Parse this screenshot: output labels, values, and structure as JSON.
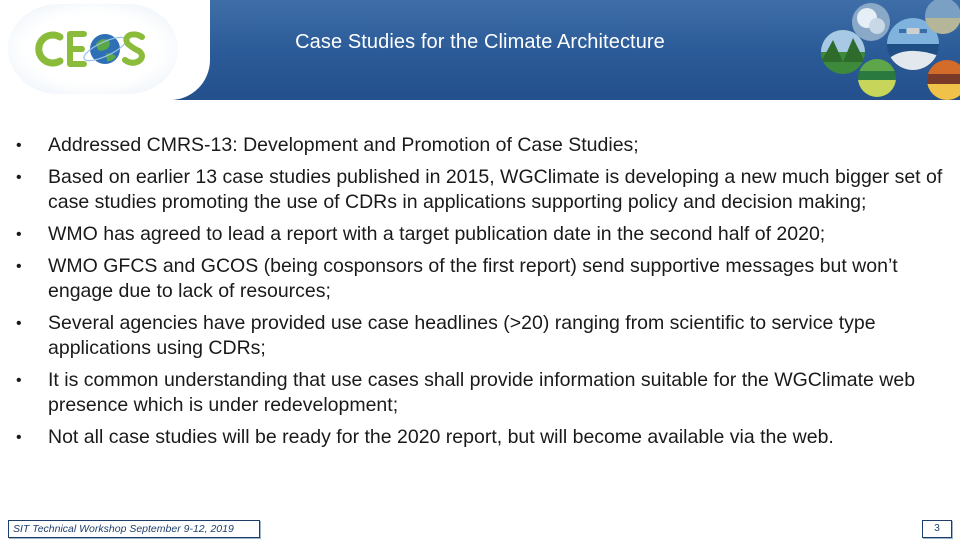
{
  "header": {
    "title": "Case Studies for the Climate Architecture",
    "logo_text": "CEOS"
  },
  "bullets": [
    "Addressed CMRS-13: Development and Promotion of Case Studies;",
    "Based on earlier 13 case studies published in 2015, WGClimate is developing a new much bigger set of case studies promoting the use of CDRs in applications supporting policy and decision making;",
    "WMO has agreed to lead a report with a target publication date in the second half of 2020;",
    "WMO GFCS and GCOS (being cosponsors of the first report) send supportive messages but won’t engage due to lack of resources;",
    "Several agencies have provided use case headlines (>20) ranging from scientific to service type applications using CDRs;",
    "It is common understanding that use cases shall provide information suitable for the WGClimate web presence which is under redevelopment;",
    "Not all case studies will be ready for the 2020 report, but will become available via the web."
  ],
  "bullet_marker": "•",
  "footer": {
    "event": "SIT Technical Workshop September 9-12, 2019",
    "page_number": "3"
  },
  "colors": {
    "header_blue": "#2a5a97",
    "logo_green": "#8bbb3a",
    "footer_navy": "#1f3f6b"
  }
}
